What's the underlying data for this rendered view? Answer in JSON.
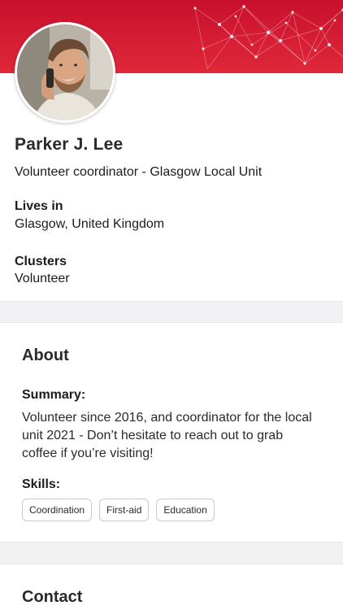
{
  "profile": {
    "name": "Parker J. Lee",
    "role": "Volunteer coordinator - Glasgow Local Unit",
    "lives_in_label": "Lives in",
    "lives_in_value": "Glasgow, United Kingdom",
    "clusters_label": "Clusters",
    "clusters_value": "Volunteer"
  },
  "about": {
    "title": "About",
    "summary_label": "Summary:",
    "summary_text": "Volunteer since 2016, and coordinator for the local unit 2021 - Don’t hesitate to reach out to grab coffee if you’re visiting!",
    "skills_label": "Skills:",
    "skills": [
      "Coordination",
      "First-aid",
      "Education"
    ]
  },
  "contact": {
    "title": "Contact"
  },
  "colors": {
    "banner_red": "#d51a30",
    "background": "#ffffff",
    "section_gap": "#f2f2f4"
  },
  "icons": {
    "banner_pattern": "network-pattern-icon"
  }
}
